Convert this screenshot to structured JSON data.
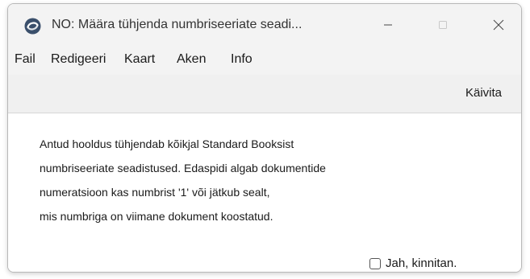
{
  "window": {
    "title": "NO: Määra tühjenda numbriseeriate seadi...",
    "icon": "app-logo-icon",
    "controls": [
      "minimize-icon",
      "maximize-icon",
      "close-icon"
    ]
  },
  "menu": {
    "items": [
      {
        "label": "Fail"
      },
      {
        "label": "Redigeeri"
      },
      {
        "label": "Kaart"
      },
      {
        "label": "Aken"
      },
      {
        "label": "Info"
      }
    ]
  },
  "toolbar": {
    "run_label": "Käivita"
  },
  "content": {
    "lines": [
      "Antud hooldus tühjendab kõikjal Standard Booksist",
      "numbriseeriate seadistused. Edaspidi algab dokumentide",
      "numeratsioon kas numbrist '1' või jätkub sealt,",
      "mis numbriga on viimane dokument koostatud."
    ],
    "confirm_label": "Jah, kinnitan.",
    "confirm_checked": false
  },
  "colors": {
    "titlebar": "#f3f3f3",
    "toolbar": "#f0f0f0",
    "content": "#ffffff",
    "disabled_control": "#c8c8c8"
  }
}
